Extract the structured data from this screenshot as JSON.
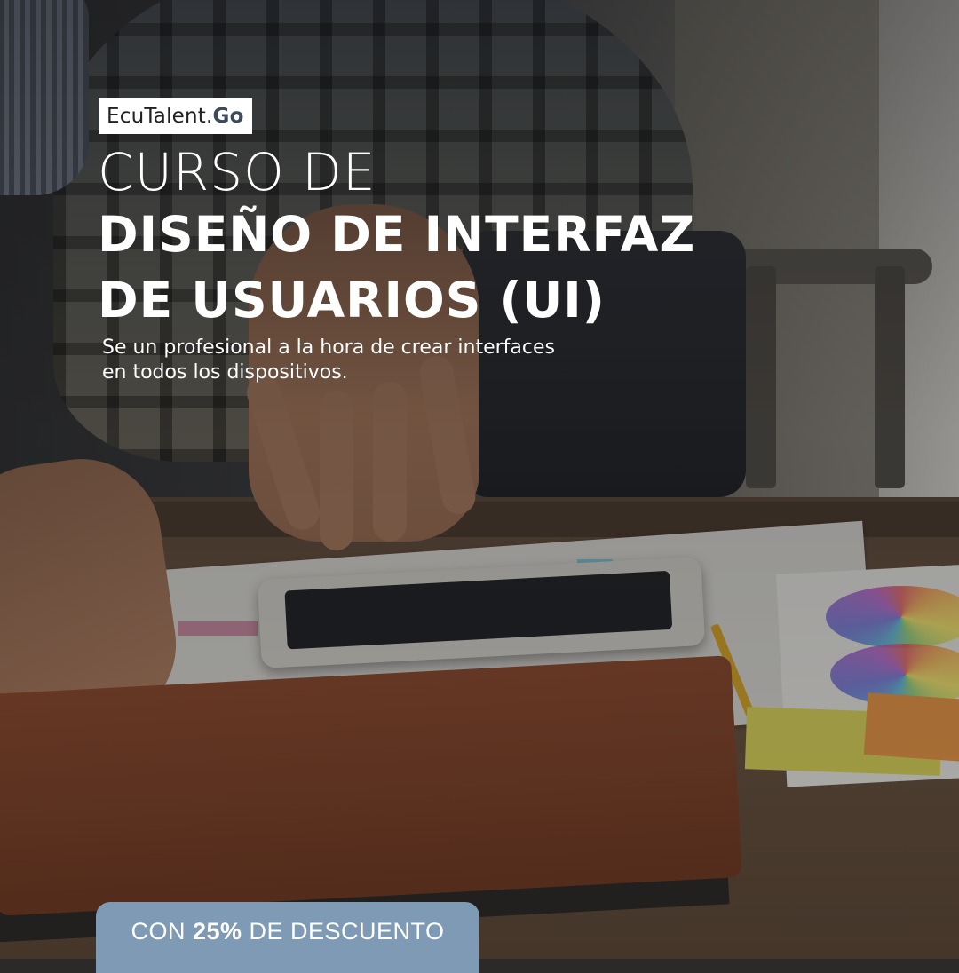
{
  "logo": {
    "brand": "EcuTalent.",
    "suffix": "Go"
  },
  "headline": {
    "line1": "CURSO DE",
    "line2": "DISEÑO DE INTERFAZ",
    "line3": "DE USUARIOS (UI)"
  },
  "subtitle": "Se un profesional a la hora de crear interfaces en todos los dispositivos.",
  "badge": {
    "prefix": "CON ",
    "highlight": "25%",
    "suffix": " DE DESCUENTO",
    "color": "#7f9ab5"
  }
}
